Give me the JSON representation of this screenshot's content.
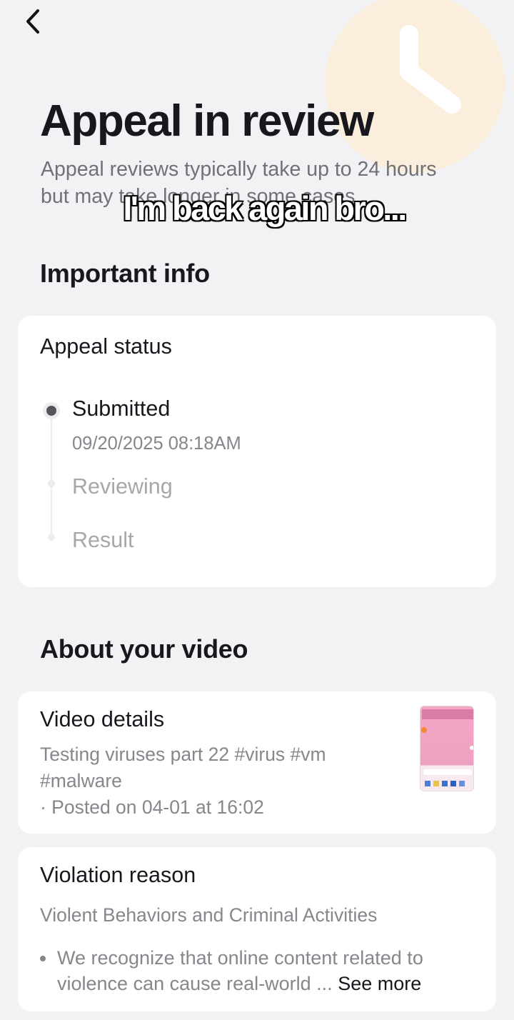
{
  "header": {
    "back_icon": "chevron-left-icon",
    "title": "Appeal in review",
    "subtitle": "Appeal reviews typically take up to 24 hours but may take longer in some cases."
  },
  "overlay_caption": "I'm back again bro...",
  "important_info": {
    "heading": "Important info",
    "appeal_status": {
      "title": "Appeal status",
      "steps": [
        {
          "label": "Submitted",
          "timestamp": "09/20/2025 08:18AM",
          "state": "active"
        },
        {
          "label": "Reviewing",
          "state": "pending"
        },
        {
          "label": "Result",
          "state": "pending"
        }
      ]
    }
  },
  "about_video": {
    "heading": "About your video",
    "video_details": {
      "title": "Video details",
      "description": "Testing viruses part 22 #virus #vm #malware",
      "posted": "· Posted on 04-01 at 16:02"
    },
    "violation": {
      "title": "Violation reason",
      "reason": "Violent Behaviors and Criminal Activities",
      "detail": "We recognize that online content related to violence can cause real-world ...",
      "see_more": "See more"
    }
  },
  "colors": {
    "background": "#f2f2f4",
    "card": "#ffffff",
    "text_primary": "#16181d",
    "text_secondary": "#85878c",
    "clock_accent": "#fbe9d2"
  }
}
